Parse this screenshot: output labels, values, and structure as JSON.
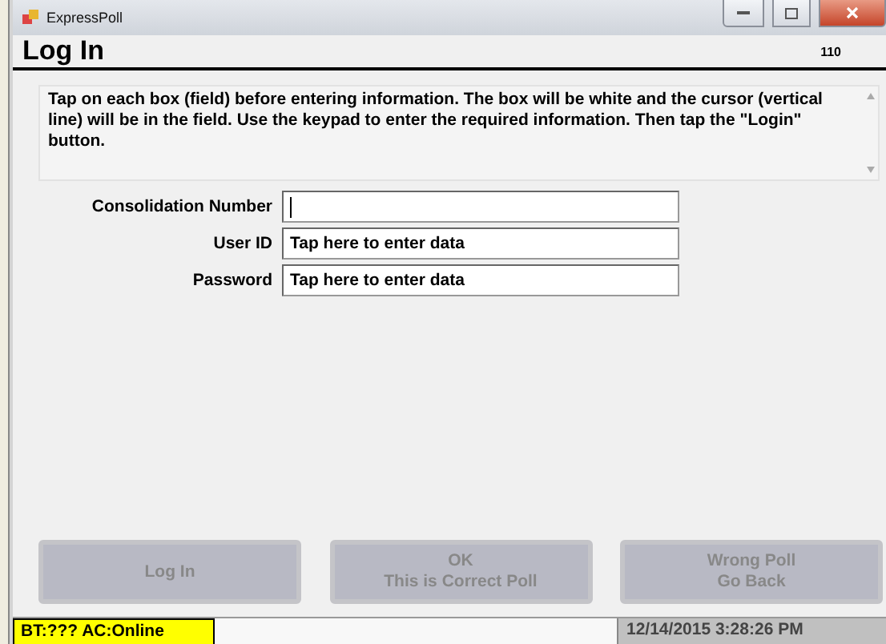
{
  "window": {
    "title": "ExpressPoll"
  },
  "header": {
    "title": "Log In",
    "code": "110"
  },
  "instructions": "Tap on each box (field) before entering information. The box will be white and the cursor (vertical line) will be in the field. Use the keypad to enter the required information. Then tap the \"Login\" button.",
  "fields": [
    {
      "label": "Consolidation Number",
      "focused": true
    },
    {
      "label": "User ID",
      "placeholder": "Tap here to enter data",
      "focused": false
    },
    {
      "label": "Password",
      "placeholder": "Tap here to enter data",
      "focused": false
    }
  ],
  "buttons": [
    {
      "lines": [
        "Log In"
      ],
      "disabled": true
    },
    {
      "lines": [
        "OK",
        "This is Correct Poll"
      ],
      "disabled": true
    },
    {
      "lines": [
        "Wrong Poll",
        "Go Back"
      ],
      "disabled": true
    }
  ],
  "status_bar": {
    "connection": "BT:??? AC:Online",
    "datetime": "12/14/2015 3:28:26 PM"
  }
}
